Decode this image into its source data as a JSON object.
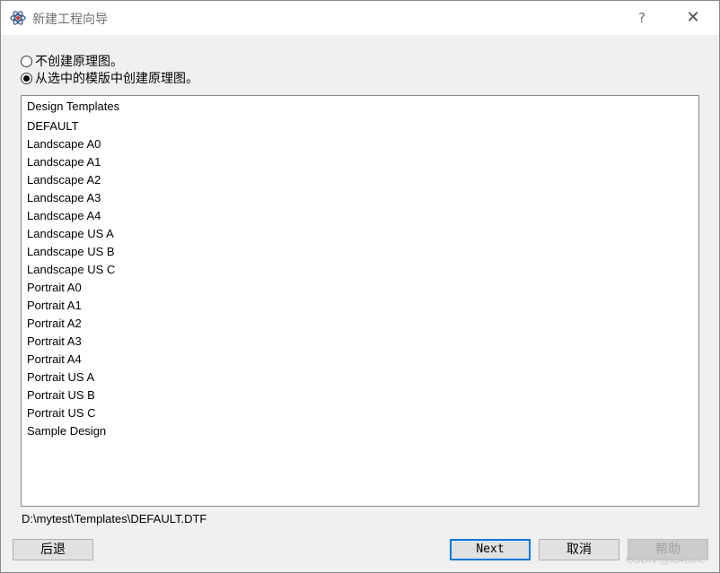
{
  "window": {
    "title": "新建工程向导",
    "help_label": "?",
    "close_label": "✕",
    "icon": "atom-icon"
  },
  "options": [
    {
      "label": "不创建原理图。",
      "checked": false
    },
    {
      "label": "从选中的模版中创建原理图。",
      "checked": true
    }
  ],
  "templates": {
    "header": "Design Templates",
    "items": [
      "DEFAULT",
      "Landscape A0",
      "Landscape A1",
      "Landscape A2",
      "Landscape A3",
      "Landscape A4",
      "Landscape US A",
      "Landscape US B",
      "Landscape US C",
      "Portrait A0",
      "Portrait A1",
      "Portrait A2",
      "Portrait A3",
      "Portrait A4",
      "Portrait US A",
      "Portrait US B",
      "Portrait US C",
      "Sample Design"
    ]
  },
  "selected_path": "D:\\mytest\\Templates\\DEFAULT.DTF",
  "buttons": {
    "back": "后退",
    "next": "Next",
    "cancel": "取消",
    "help": "帮助"
  },
  "watermark": "CSDN @la4tone",
  "colors": {
    "focus_border": "#0078d7",
    "disabled_text": "#a0a0a0"
  }
}
